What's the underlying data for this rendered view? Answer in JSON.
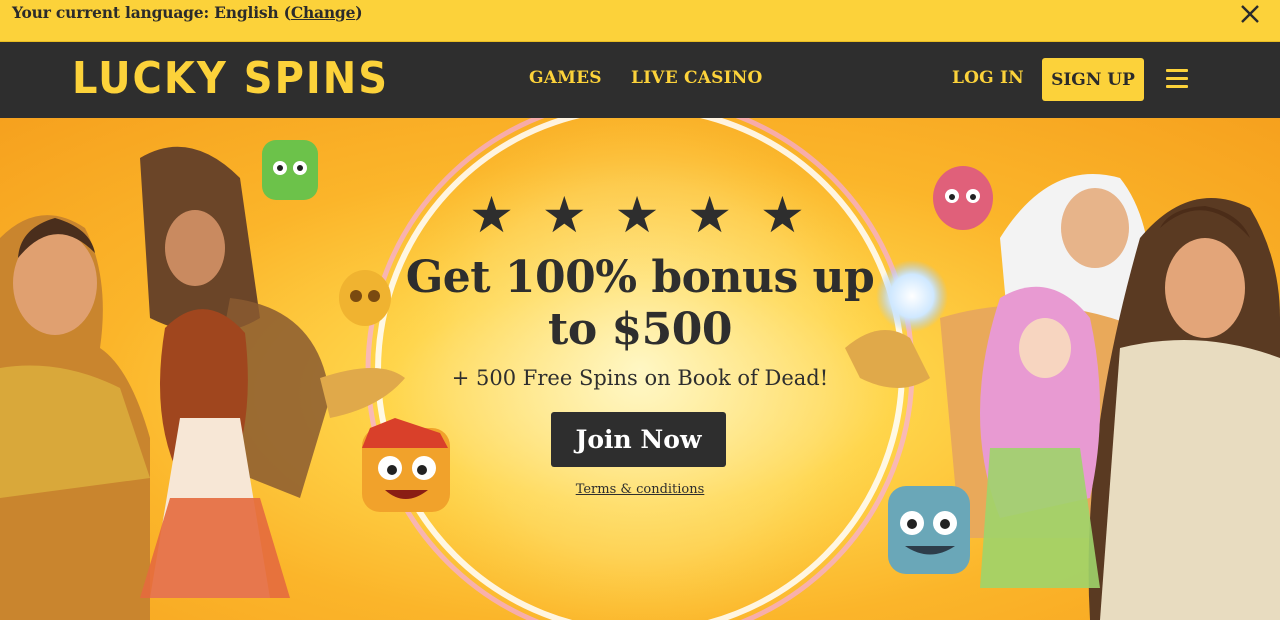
{
  "language_bar": {
    "prefix": "Your current language: English (",
    "change_link": "Change",
    "suffix": ")",
    "close_icon": "close-icon"
  },
  "header": {
    "logo": "LUCKY SPINS",
    "nav": [
      "GAMES",
      "LIVE CASINO"
    ],
    "login": "LOG IN",
    "signup": "SIGN UP",
    "menu_icon": "hamburger-menu-icon"
  },
  "hero": {
    "stars": "★ ★ ★ ★ ★",
    "headline": "Get 100% bonus up to $500",
    "subline": "+ 500 Free Spins on Book of Dead!",
    "cta": "Join Now",
    "terms": "Terms & conditions"
  },
  "colors": {
    "accent_yellow": "#fcd23a",
    "header_dark": "#2e2e2e",
    "text_dark": "#2b2b2b"
  }
}
